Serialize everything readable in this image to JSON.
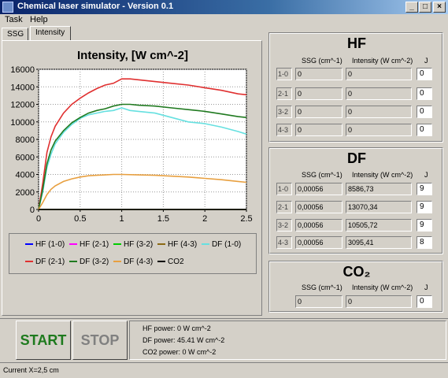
{
  "window": {
    "title": "Chemical laser simulator - Version 0.1",
    "min": "_",
    "max": "□",
    "close": "×"
  },
  "menu": {
    "task": "Task",
    "help": "Help"
  },
  "tabs": {
    "ssg": "SSG",
    "intensity": "Intensity"
  },
  "chart_data": {
    "type": "line",
    "title": "Intensity, [W cm^-2]",
    "xlim": [
      0,
      2.5
    ],
    "ylim": [
      0,
      16000
    ],
    "xticks": [
      "0",
      "0.5",
      "1",
      "1.5",
      "2",
      "2.5"
    ],
    "yticks": [
      "0",
      "2000",
      "4000",
      "6000",
      "8000",
      "10000",
      "12000",
      "14000",
      "16000"
    ],
    "grid": true,
    "legend_position": "bottom",
    "series": [
      {
        "name": "HF (1-0)",
        "color": "#0000ff",
        "x": [
          0,
          2.5
        ],
        "y": [
          0,
          0
        ]
      },
      {
        "name": "HF (2-1)",
        "color": "#ff00ff",
        "x": [
          0,
          2.5
        ],
        "y": [
          0,
          0
        ]
      },
      {
        "name": "HF (3-2)",
        "color": "#00cc00",
        "x": [
          0,
          2.5
        ],
        "y": [
          0,
          0
        ]
      },
      {
        "name": "HF (4-3)",
        "color": "#8b6914",
        "x": [
          0,
          2.5
        ],
        "y": [
          0,
          0
        ]
      },
      {
        "name": "DF (1-0)",
        "color": "#66e0e0",
        "x": [
          0,
          0.05,
          0.1,
          0.15,
          0.2,
          0.3,
          0.4,
          0.5,
          0.6,
          0.7,
          0.8,
          0.9,
          1.0,
          1.1,
          1.2,
          1.4,
          1.6,
          1.8,
          2.0,
          2.2,
          2.4,
          2.5
        ],
        "y": [
          0,
          2000,
          4800,
          6300,
          7500,
          8800,
          9700,
          10400,
          10800,
          11000,
          11200,
          11300,
          11600,
          11300,
          11200,
          11000,
          10500,
          10000,
          9800,
          9400,
          8900,
          8600
        ]
      },
      {
        "name": "DF (2-1)",
        "color": "#e03030",
        "x": [
          0,
          0.05,
          0.1,
          0.15,
          0.2,
          0.3,
          0.4,
          0.5,
          0.6,
          0.7,
          0.8,
          0.9,
          1.0,
          1.1,
          1.2,
          1.4,
          1.6,
          1.8,
          2.0,
          2.2,
          2.4,
          2.5
        ],
        "y": [
          0,
          3000,
          6500,
          8300,
          9500,
          11000,
          12000,
          12700,
          13300,
          13800,
          14200,
          14400,
          14900,
          14900,
          14800,
          14600,
          14400,
          14200,
          13900,
          13600,
          13200,
          13100
        ]
      },
      {
        "name": "DF (3-2)",
        "color": "#207a20",
        "x": [
          0,
          0.05,
          0.1,
          0.15,
          0.2,
          0.3,
          0.4,
          0.5,
          0.6,
          0.7,
          0.8,
          0.9,
          1.0,
          1.1,
          1.2,
          1.4,
          1.6,
          1.8,
          2.0,
          2.2,
          2.4,
          2.5
        ],
        "y": [
          0,
          2300,
          5200,
          6800,
          7800,
          9000,
          9900,
          10500,
          11000,
          11300,
          11500,
          11800,
          12000,
          12000,
          11900,
          11800,
          11600,
          11400,
          11200,
          10900,
          10600,
          10500
        ]
      },
      {
        "name": "DF (4-3)",
        "color": "#e8a040",
        "x": [
          0,
          0.05,
          0.1,
          0.15,
          0.2,
          0.3,
          0.4,
          0.5,
          0.6,
          0.7,
          0.8,
          0.9,
          1.0,
          1.2,
          1.4,
          1.6,
          1.8,
          2.0,
          2.2,
          2.4,
          2.5
        ],
        "y": [
          0,
          800,
          1700,
          2300,
          2700,
          3200,
          3500,
          3700,
          3850,
          3900,
          3950,
          4000,
          4000,
          3950,
          3900,
          3800,
          3700,
          3550,
          3400,
          3200,
          3100
        ]
      },
      {
        "name": "CO2",
        "color": "#000000",
        "x": [
          0,
          2.5
        ],
        "y": [
          0,
          0
        ]
      }
    ]
  },
  "hf": {
    "title": "HF",
    "h_ssg": "SSG (cm^-1)",
    "h_int": "Intensity (W cm^-2)",
    "h_j": "J",
    "rows": [
      {
        "label": "1-0",
        "ssg": "0",
        "intensity": "0",
        "j": "0"
      },
      {
        "label": "2-1",
        "ssg": "0",
        "intensity": "0",
        "j": "0"
      },
      {
        "label": "3-2",
        "ssg": "0",
        "intensity": "0",
        "j": "0"
      },
      {
        "label": "4-3",
        "ssg": "0",
        "intensity": "0",
        "j": "0"
      }
    ]
  },
  "df": {
    "title": "DF",
    "h_ssg": "SSG (cm^-1)",
    "h_int": "Intensity (W cm^-2)",
    "h_j": "J",
    "rows": [
      {
        "label": "1-0",
        "ssg": "0,00056",
        "intensity": "8586,73",
        "j": "9"
      },
      {
        "label": "2-1",
        "ssg": "0,00056",
        "intensity": "13070,34",
        "j": "9"
      },
      {
        "label": "3-2",
        "ssg": "0,00056",
        "intensity": "10505,72",
        "j": "9"
      },
      {
        "label": "4-3",
        "ssg": "0,00056",
        "intensity": "3095,41",
        "j": "8"
      }
    ]
  },
  "co2": {
    "title": "CO₂",
    "h_ssg": "SSG (cm^-1)",
    "h_int": "Intensity (W cm^-2)",
    "h_j": "J",
    "ssg": "0",
    "intensity": "0",
    "j": "0"
  },
  "controls": {
    "start": "START",
    "stop": "STOP",
    "start_color": "#1e7a1e",
    "stop_color": "#808080"
  },
  "powers": {
    "hf": "HF power: 0 W cm^-2",
    "df": "DF power: 45.41 W cm^-2",
    "co2": "CO2 power: 0 W cm^-2"
  },
  "status": "Current X=2,5 cm"
}
